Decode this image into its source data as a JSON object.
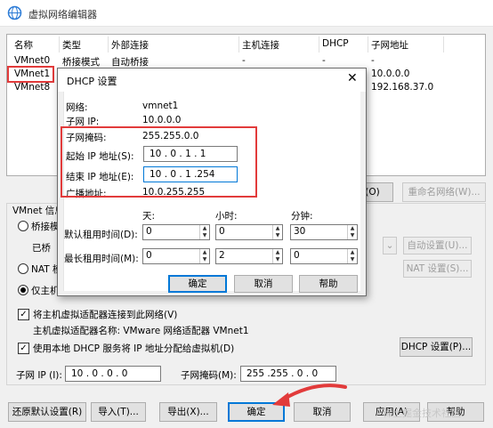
{
  "window": {
    "title": "虚拟网络编辑器"
  },
  "netlist": {
    "headers": [
      "名称",
      "类型",
      "外部连接",
      "主机连接",
      "DHCP",
      "子网地址"
    ],
    "rows": [
      [
        "VMnet0",
        "桥接模式",
        "自动桥接",
        "-",
        "-",
        "-"
      ],
      [
        "VMnet1",
        "",
        "",
        "",
        "",
        "10.0.0.0"
      ],
      [
        "VMnet8",
        "",
        "",
        "",
        "",
        "192.168.37.0"
      ]
    ]
  },
  "side_buttons": {
    "remove_tail": "(O)",
    "rename": "重命名网络(W)..."
  },
  "vmnet_group": {
    "title": "VMnet 信息",
    "bridge": "桥接模",
    "bridged_to": "已桥",
    "nat": "NAT 模",
    "host_only": "仅主机",
    "auto_settings": "自动设置(U)...",
    "nat_settings": "NAT 设置(S)...",
    "connect_adapter": "将主机虚拟适配器连接到此网络(V)",
    "adapter_name": "主机虚拟适配器名称: VMware 网络适配器 VMnet1",
    "use_dhcp": "使用本地 DHCP 服务将 IP 地址分配给虚拟机(D)",
    "dhcp_settings": "DHCP 设置(P)...",
    "subnet_ip_label": "子网 IP (I):",
    "subnet_ip": "10 .  0 .  0 .  0",
    "subnet_mask_label": "子网掩码(M):",
    "subnet_mask": "255 .255 .  0 .  0"
  },
  "bottom_buttons": {
    "restore": "还原默认设置(R)",
    "import": "导入(T)...",
    "export": "导出(X)...",
    "ok": "确定",
    "cancel": "取消",
    "apply": "应用(A)",
    "help": "帮助"
  },
  "dhcp": {
    "title": "DHCP 设置",
    "network_label": "网络:",
    "network": "vmnet1",
    "subnet_ip_label": "子网 IP:",
    "subnet_ip": "10.0.0.0",
    "mask_label": "子网掩码:",
    "mask": "255.255.0.0",
    "start_label": "起始 IP 地址(S):",
    "start": "10  .  0  .  1  .  1",
    "end_label": "结束 IP 地址(E):",
    "end": "10  .  0  .  1  .254",
    "broadcast_label": "广播地址:",
    "broadcast": "10.0.255.255",
    "col_day": "天:",
    "col_hour": "小时:",
    "col_min": "分钟:",
    "default_lease_label": "默认租用时间(D):",
    "default_lease": [
      "0",
      "0",
      "30"
    ],
    "max_lease_label": "最长租用时间(M):",
    "max_lease": [
      "0",
      "2",
      "0"
    ],
    "ok": "确定",
    "cancel": "取消",
    "help": "帮助"
  },
  "watermark": "稀土掘金技术社区",
  "colors": {
    "accent": "#0078d7",
    "highlight": "#e23b3b"
  }
}
